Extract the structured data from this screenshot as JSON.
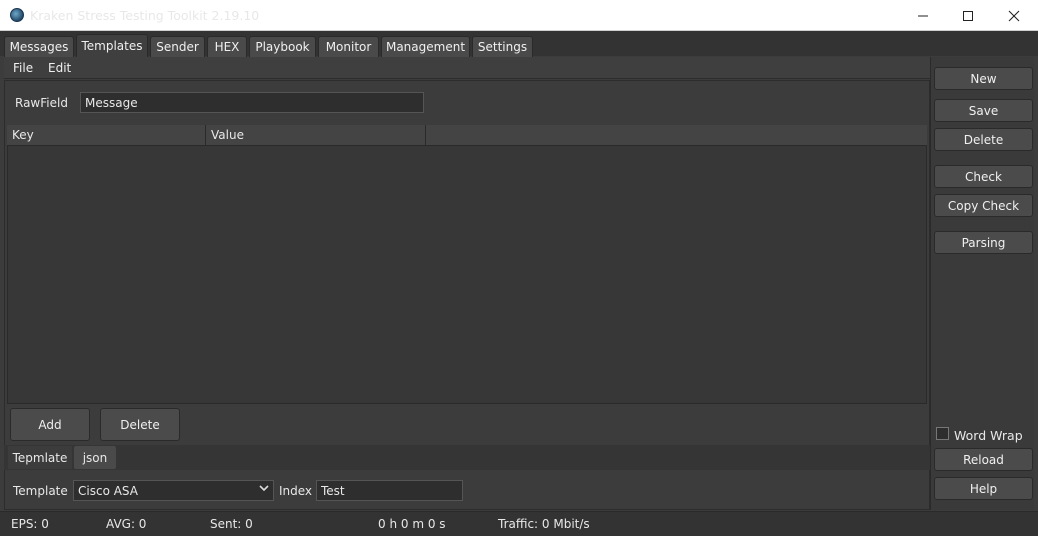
{
  "window": {
    "title": "Kraken Stress Testing Toolkit 2.19.10"
  },
  "tabs": [
    "Messages",
    "Templates",
    "Sender",
    "HEX",
    "Playbook",
    "Monitor",
    "Management",
    "Settings"
  ],
  "menu": [
    "File",
    "Edit"
  ],
  "rawfield": {
    "label": "RawField",
    "value": "Message"
  },
  "table": {
    "columns": [
      "Key",
      "Value"
    ]
  },
  "row_buttons": {
    "add": "Add",
    "delete": "Delete"
  },
  "subtabs": [
    "Tepmlate",
    "json"
  ],
  "template": {
    "label": "Template",
    "selected": "Cisco ASA"
  },
  "index": {
    "label": "Index",
    "value": "Test"
  },
  "side_buttons": {
    "new": "New",
    "save": "Save",
    "delete": "Delete",
    "check": "Check",
    "copy_check": "Copy Check",
    "parsing": "Parsing",
    "reload": "Reload",
    "help": "Help"
  },
  "word_wrap": {
    "label": "Word Wrap",
    "checked": false
  },
  "status": {
    "eps": "EPS: 0",
    "avg": "AVG: 0",
    "sent": "Sent: 0",
    "time": "0 h 0 m 0 s",
    "traffic": "Traffic: 0 Mbit/s"
  },
  "colors": {
    "background": "#3c3c3c",
    "panel": "#373737",
    "button": "#4b4b4b",
    "text": "#e8e8e8"
  }
}
